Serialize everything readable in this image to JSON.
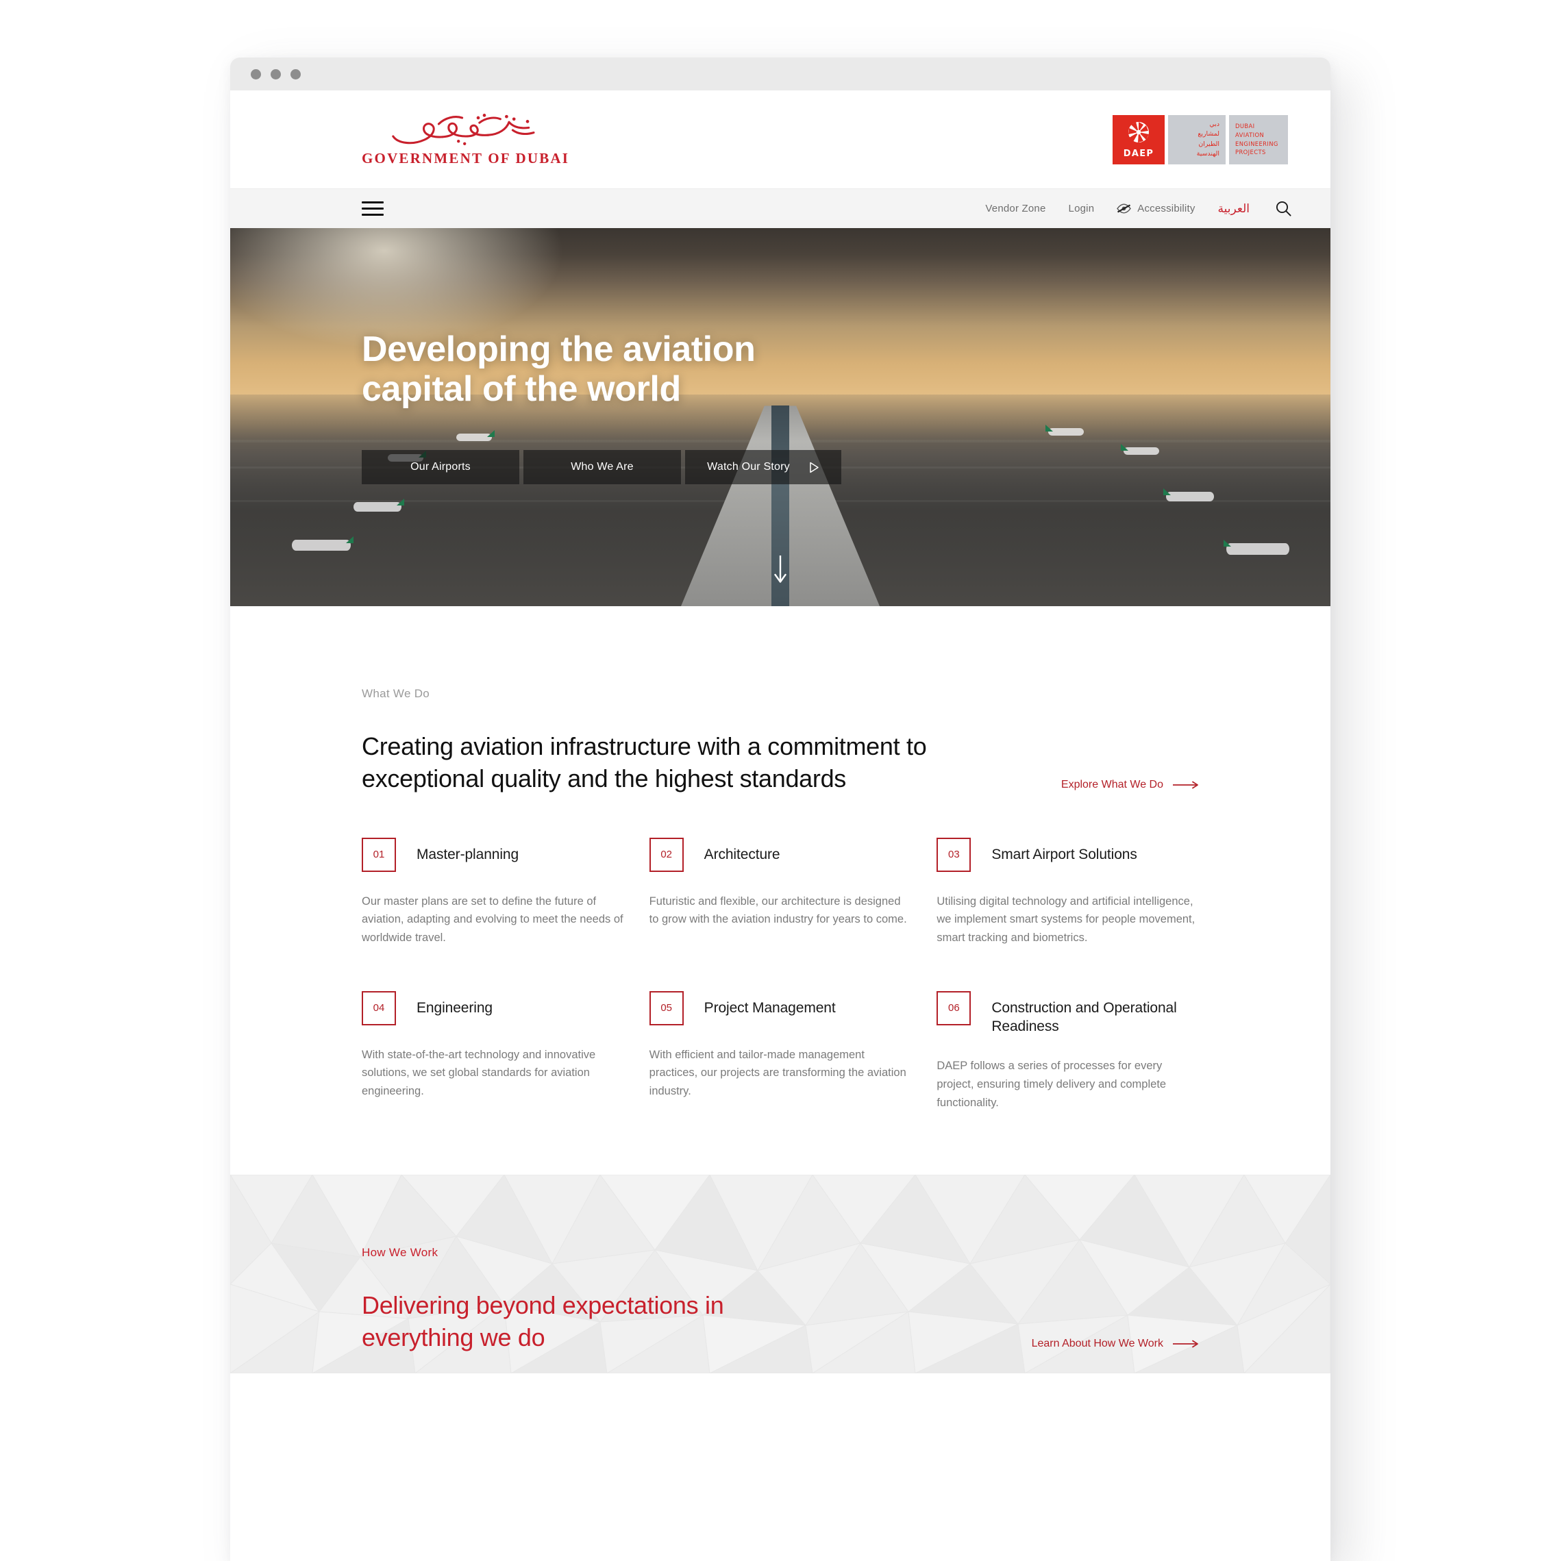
{
  "browser": {
    "dots": [
      "",
      "",
      ""
    ]
  },
  "header": {
    "gov_logo": {
      "arabic_alt": "حكومة دبي",
      "latin": "GOVERNMENT OF DUBAI"
    },
    "daep_logo": {
      "wordmark": "DAEP",
      "arabic_lines": [
        "دبي",
        "لمشاريع",
        "الطيران",
        "الهندسية"
      ],
      "english_lines": [
        "DUBAI",
        "AVIATION",
        "ENGINEERING",
        "PROJECTS"
      ]
    }
  },
  "nav": {
    "menu_icon": "hamburger-icon",
    "links": [
      {
        "label": "Vendor Zone",
        "icon": null
      },
      {
        "label": "Login",
        "icon": null
      },
      {
        "label": "Accessibility",
        "icon": "eye-slash-icon"
      }
    ],
    "arabic_toggle": "العربية",
    "search_icon": "search-icon"
  },
  "hero": {
    "title_line1": "Developing the aviation",
    "title_line2": "capital of the world",
    "buttons": [
      {
        "label": "Our Airports",
        "icon": null
      },
      {
        "label": "Who We Are",
        "icon": null
      },
      {
        "label": "Watch Our Story",
        "icon": "play-icon"
      }
    ],
    "scroll_icon": "arrow-down-icon"
  },
  "what_we_do": {
    "eyebrow": "What We Do",
    "title": "Creating aviation infrastructure with a commitment to exceptional quality and the highest standards",
    "cta": {
      "label": "Explore What We Do",
      "icon": "arrow-right-icon"
    },
    "services": [
      {
        "number": "01",
        "title": "Master-planning",
        "description": "Our master plans are set to define the future of aviation, adapting and evolving to meet the needs of worldwide travel."
      },
      {
        "number": "02",
        "title": "Architecture",
        "description": "Futuristic and flexible, our architecture is designed to grow with the aviation industry for years to come."
      },
      {
        "number": "03",
        "title": "Smart Airport Solutions",
        "description": "Utilising digital technology and artificial intelligence, we implement smart systems for people movement, smart tracking and biometrics."
      },
      {
        "number": "04",
        "title": "Engineering",
        "description": "With state-of-the-art technology and innovative solutions, we set global standards for aviation engineering."
      },
      {
        "number": "05",
        "title": "Project Management",
        "description": "With efficient and tailor-made management practices, our projects are transforming the aviation industry."
      },
      {
        "number": "06",
        "title": "Construction and Operational Readiness",
        "description": "DAEP follows a series of processes for every project, ensuring timely delivery and complete functionality."
      }
    ]
  },
  "how_we_work": {
    "eyebrow": "How We Work",
    "title_line1": "Delivering beyond expectations in",
    "title_line2": "everything we do",
    "cta": {
      "label": "Learn About How We Work",
      "icon": "arrow-right-icon"
    }
  },
  "colors": {
    "brand_red": "#c8202c",
    "daep_red": "#e02b20",
    "link_red": "#b32028",
    "text_dark": "#111111",
    "text_muted": "#7b7b7b",
    "nav_bg": "#f4f4f4",
    "section_bg": "#efefef"
  }
}
